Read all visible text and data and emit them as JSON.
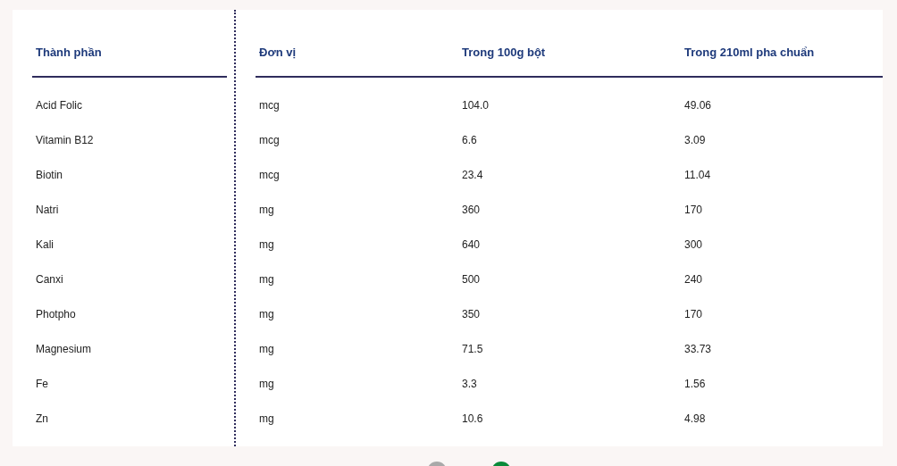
{
  "table": {
    "columns": [
      "Thành phần",
      "Đơn vị",
      "Trong 100g bột",
      "Trong 210ml pha chuẩn"
    ],
    "rows": [
      [
        "Acid Folic",
        "mcg",
        "104.0",
        "49.06"
      ],
      [
        "Vitamin B12",
        "mcg",
        "6.6",
        "3.09"
      ],
      [
        "Biotin",
        "mcg",
        "23.4",
        "11.04"
      ],
      [
        "Natri",
        "mg",
        "360",
        "170"
      ],
      [
        "Kali",
        "mg",
        "640",
        "300"
      ],
      [
        "Canxi",
        "mg",
        "500",
        "240"
      ],
      [
        "Photpho",
        "mg",
        "350",
        "170"
      ],
      [
        "Magnesium",
        "mg",
        "71.5",
        "33.73"
      ],
      [
        "Fe",
        "mg",
        "3.3",
        "1.56"
      ],
      [
        "Zn",
        "mg",
        "10.6",
        "4.98"
      ]
    ]
  },
  "pagination": [
    {
      "selected": false
    },
    {
      "selected": true
    }
  ]
}
